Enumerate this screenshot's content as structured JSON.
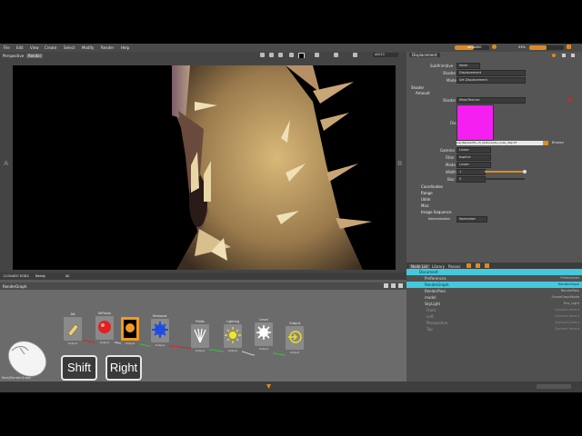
{
  "menu": [
    "File",
    "Edit",
    "View",
    "Create",
    "Select",
    "Modify",
    "Render",
    "Help"
  ],
  "menubar_right": {
    "progress_a": 0.55,
    "progress_b": 0.5,
    "field_a": "ab2b000",
    "field_b": "53%"
  },
  "viewport": {
    "tabs": [
      "Perspective",
      "Render"
    ],
    "active_tab": "Render",
    "res_value": "all010",
    "side_left": "A",
    "side_right": "B",
    "status_res": "1100x800 RGBA",
    "status_state": "Ready",
    "status_filter": "All"
  },
  "graph": {
    "title": "RenderGraph",
    "footer": "Root|RenderGraph",
    "nodes": [
      {
        "label": "Att",
        "port": "Output",
        "icon": "tag-icon",
        "color": "#e9d27a"
      },
      {
        "label": "ShFinish",
        "port": "Output",
        "icon": "red-sphere-icon",
        "color": "#e22020"
      },
      {
        "label": "",
        "port": "Output",
        "icon": "camera-body-icon",
        "color": "#f19a22"
      },
      {
        "label": "Remover",
        "port": "Output",
        "icon": "gear-blue-icon",
        "color": "#1f4ce0"
      },
      {
        "label": "Fields",
        "port": "Output",
        "icon": "fan-icon",
        "color": "#ffffff"
      },
      {
        "label": "Lighting",
        "port": "Output",
        "icon": "sun-icon",
        "color": "#f3e91a"
      },
      {
        "label": "Level",
        "port": "Output",
        "icon": "cog-icon",
        "color": "#ffffff"
      },
      {
        "label": "Output",
        "port": "Output",
        "icon": "output-icon",
        "color": "#efe022"
      }
    ]
  },
  "keys": {
    "shift": "Shift",
    "right": "Right"
  },
  "panel": {
    "tab": "Displacement",
    "subdivision_label": "SubPrimitive",
    "subdivision_value": "None",
    "shader_label": "Shader",
    "shader_value": "Displacement",
    "mode_label": "Mode",
    "mode_value": "Set Displacement",
    "group_shader": "Shader",
    "group_amount": "Amount",
    "shader2_label": "Shader",
    "shader2_value": "MixerTexture",
    "file_label": "File",
    "file_path": "/usr/RenderMo_ch_textures/bu_nose_disp.tif",
    "browse": "Browse",
    "swatch_color": "#f41ff0",
    "gamma_label": "Gamma",
    "gamma_value": "Linear",
    "filter_label": "Filter",
    "filter_value": "bspline",
    "mode2_label": "Mode",
    "mode2_value": "Linear",
    "width_label": "Width",
    "width_value": "1",
    "blur_label": "Blur",
    "blur_value": "0",
    "sections": [
      "Coordinates",
      "Range",
      "Udim",
      "Misc",
      "Image Sequence"
    ],
    "normalization_label": "Normalization",
    "normalization_value": "Normalize"
  },
  "layer_tabs": [
    "Node List",
    "Library",
    "Passes"
  ],
  "layer_list": [
    {
      "name": "Document",
      "type": "",
      "selected": true
    },
    {
      "name": "Preferences",
      "type": "Preferences",
      "selected": false
    },
    {
      "name": "RenderGraph",
      "type": "RenderGraph",
      "selected": true
    },
    {
      "name": "RenderPass",
      "type": "RenderPass",
      "selected": false
    },
    {
      "name": "model",
      "type": "SceneGraphNode",
      "selected": false
    },
    {
      "name": "SkyLight",
      "type": "Env_Light",
      "selected": false
    },
    {
      "name": "Front",
      "type": "SystemCamera",
      "selected": false
    },
    {
      "name": "Left",
      "type": "SystemCamera",
      "selected": false
    },
    {
      "name": "Perspective",
      "type": "SystemCamera",
      "selected": false
    },
    {
      "name": "Top",
      "type": "SystemCamera",
      "selected": false
    }
  ],
  "colors": {
    "accent": "#e08a1e",
    "selection": "#44c8dc",
    "swatch": "#f41ff0"
  }
}
